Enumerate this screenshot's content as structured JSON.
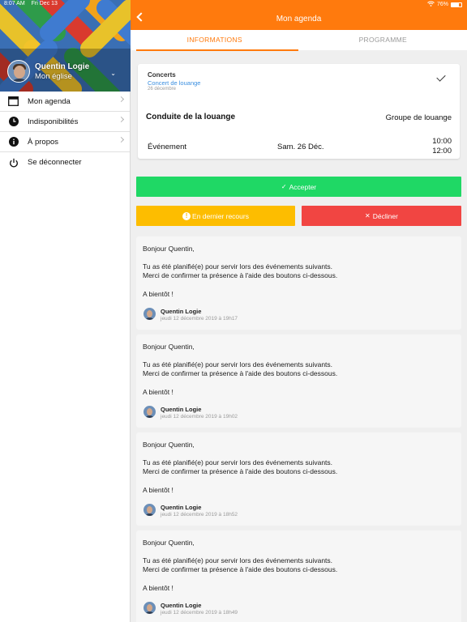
{
  "status_bar": {
    "time": "8:07 AM",
    "date": "Fri Dec 13",
    "battery": "76%",
    "battery_level": 0.76
  },
  "sidebar": {
    "profile": {
      "name": "Quentin Logie",
      "church": "Mon église"
    },
    "menu": [
      {
        "label": "Mon agenda",
        "icon": "calendar-icon",
        "chevron": true
      },
      {
        "label": "Indisponibilités",
        "icon": "clock-icon",
        "chevron": true
      },
      {
        "label": "À propos",
        "icon": "info-icon",
        "chevron": true
      },
      {
        "label": "Se déconnecter",
        "icon": "power-icon",
        "chevron": false
      }
    ]
  },
  "header": {
    "title": "Mon agenda"
  },
  "tabs": [
    {
      "label": "INFORMATIONS",
      "active": true
    },
    {
      "label": "PROGRAMME",
      "active": false
    }
  ],
  "event": {
    "category": "Concerts",
    "subtitle": "Concert de louange",
    "date_small": "26 décembre",
    "role": "Conduite de la louange",
    "group": "Groupe de louange",
    "type": "Événement",
    "day": "Sam. 26 Déc.",
    "start": "10:00",
    "end": "12:00"
  },
  "actions": {
    "accept": "Accepter",
    "last_resort": "En dernier recours",
    "decline": "Décliner"
  },
  "messages": [
    {
      "greeting": "Bonjour Quentin,",
      "line1": "Tu as été planifié(e) pour servir lors des événements suivants.",
      "line2": "Merci de confirmer ta présence à l'aide des boutons ci-dessous.",
      "bye": "A bientôt !",
      "author": "Quentin Logie",
      "time": "jeudi 12 décembre 2019 à 19h17"
    },
    {
      "greeting": "Bonjour Quentin,",
      "line1": "Tu as été planifié(e) pour servir lors des événements suivants.",
      "line2": "Merci de confirmer ta présence à l'aide des boutons ci-dessous.",
      "bye": "A bientôt !",
      "author": "Quentin Logie",
      "time": "jeudi 12 décembre 2019 à 19h02"
    },
    {
      "greeting": "Bonjour Quentin,",
      "line1": "Tu as été planifié(e) pour servir lors des événements suivants.",
      "line2": "Merci de confirmer ta présence à l'aide des boutons ci-dessous.",
      "bye": "A bientôt !",
      "author": "Quentin Logie",
      "time": "jeudi 12 décembre 2019 à 18h52"
    },
    {
      "greeting": "Bonjour Quentin,",
      "line1": "Tu as été planifié(e) pour servir lors des événements suivants.",
      "line2": "Merci de confirmer ta présence à l'aide des boutons ci-dessous.",
      "bye": "A bientôt !",
      "author": "Quentin Logie",
      "time": "jeudi 12 décembre 2019 à 18h49"
    }
  ],
  "colors": {
    "accent": "#ff7a0d",
    "accept": "#1fd865",
    "last_resort": "#fdbd00",
    "decline": "#f14542",
    "link": "#3b8fe0"
  }
}
